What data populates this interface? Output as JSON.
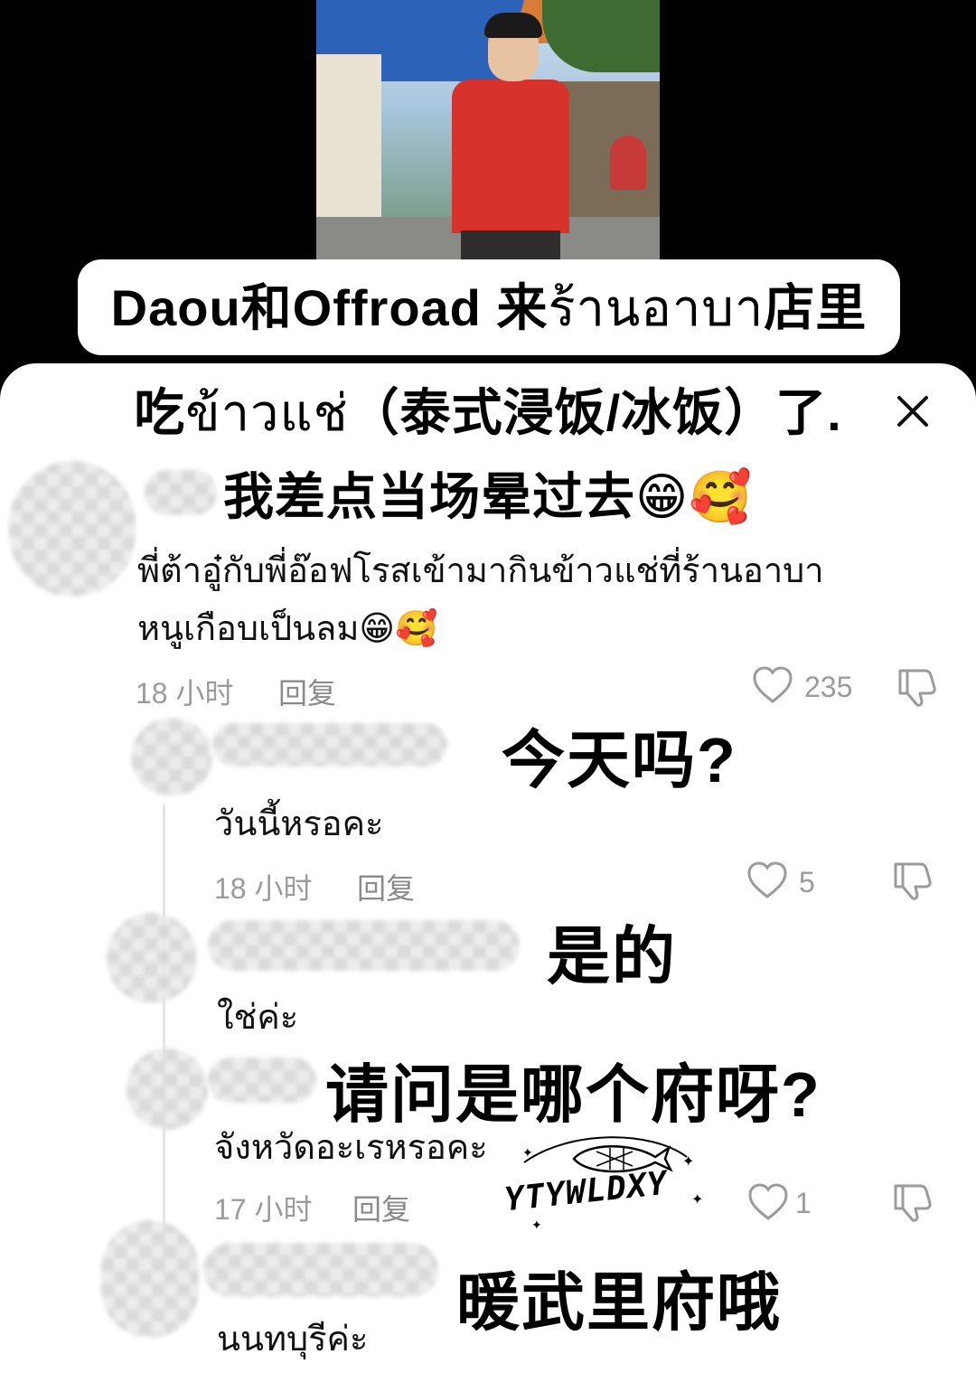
{
  "caption": {
    "line1_a": "Daou和Offroad 来",
    "line1_th": "ร้านอาบา",
    "line1_b": "店里",
    "line2_a": "吃",
    "line2_th": "ข้าวแช่",
    "line2_b": "（泰式浸饭/冰饭）了.",
    "line3": "我差点当场晕过去😁🥰"
  },
  "comments": [
    {
      "text_line1": "พี่ต้าอู๋กับพี่อ๊อฟโรสเข้ามากินข้าวแช่ที่ร้านอาบา",
      "text_line2": "หนูเกือบเป็นลม😁🥰",
      "time": "18 小时",
      "reply_label": "回复",
      "likes": "235"
    },
    {
      "translation": "今天吗?",
      "text": "วันนี้หรอคะ",
      "time": "18 小时",
      "reply_label": "回复",
      "likes": "5"
    },
    {
      "translation": "是的",
      "text": "ใช่ค่ะ"
    },
    {
      "translation": "请问是哪个府呀?",
      "text": "จังหวัดอะเรหรอคะ",
      "time": "17 小时",
      "reply_label": "回复",
      "likes": "1"
    },
    {
      "translation": "暖武里府哦",
      "text": "นนทบุรีค่ะ"
    }
  ],
  "watermark": "YTYWLDXY",
  "icons": {
    "close": "close-icon",
    "like": "heart-icon",
    "dislike": "thumbs-down-icon"
  }
}
